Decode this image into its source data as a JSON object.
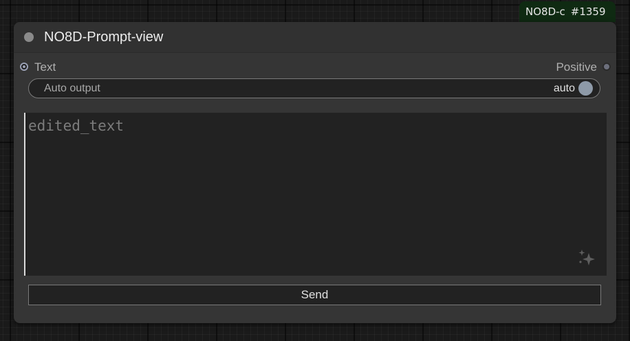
{
  "badge": {
    "name": "NO8D-c",
    "id": "#1359"
  },
  "node": {
    "title": "NO8D-Prompt-view",
    "input_slot": {
      "label": "Text"
    },
    "output_slot": {
      "label": "Positive"
    },
    "toggle": {
      "label": "Auto output",
      "value": "auto"
    },
    "textarea": {
      "placeholder": "edited_text",
      "value": ""
    },
    "send_label": "Send",
    "icons": {
      "title_dot": "collapse-dot-icon",
      "sparkle": "sparkle-icon"
    }
  }
}
